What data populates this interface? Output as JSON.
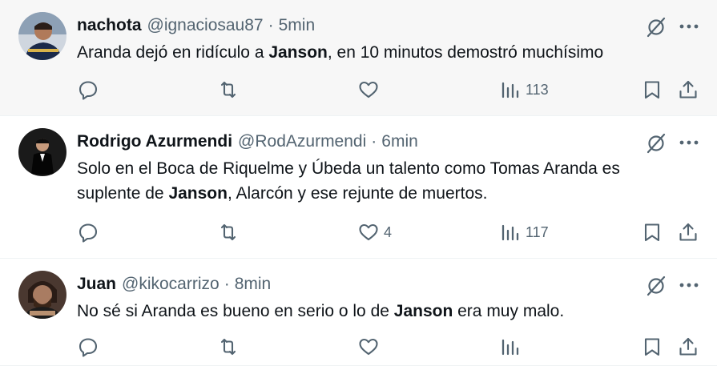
{
  "tweets": [
    {
      "name": "nachota",
      "handle": "@ignaciosau87",
      "separator": "·",
      "time": "5min",
      "text_parts": [
        {
          "text": "Aranda dejó en ridículo a ",
          "bold": false
        },
        {
          "text": "Janson",
          "bold": true
        },
        {
          "text": ", en 10 minutos demostró muchísimo",
          "bold": false
        }
      ],
      "replies": "",
      "retweets": "",
      "likes": "",
      "views": "113",
      "avatar_colors": [
        "#1b2a4a",
        "#d8b24a"
      ]
    },
    {
      "name": "Rodrigo Azurmendi",
      "handle": "@RodAzurmendi",
      "separator": "·",
      "time": "6min",
      "text_parts": [
        {
          "text": "Solo en el Boca de Riquelme y Úbeda un talento como Tomas Aranda es suplente de ",
          "bold": false
        },
        {
          "text": "Janson",
          "bold": true
        },
        {
          "text": ", Alarcón y ese rejunte de muertos.",
          "bold": false
        }
      ],
      "replies": "",
      "retweets": "",
      "likes": "4",
      "views": "117",
      "avatar_colors": [
        "#111111",
        "#e0e0e0"
      ]
    },
    {
      "name": "Juan",
      "handle": "@kikocarrizo",
      "separator": "·",
      "time": "8min",
      "text_parts": [
        {
          "text": "No sé si Aranda es bueno en serio o lo de ",
          "bold": false
        },
        {
          "text": "Janson",
          "bold": true
        },
        {
          "text": " era muy malo.",
          "bold": false
        }
      ],
      "replies": "",
      "retweets": "",
      "likes": "",
      "views": "",
      "avatar_colors": [
        "#3a2a22",
        "#b89070"
      ]
    }
  ],
  "icons": {
    "reply": "reply-icon",
    "retweet": "retweet-icon",
    "like": "heart-icon",
    "views": "views-icon",
    "bookmark": "bookmark-icon",
    "share": "share-icon",
    "grok": "grok-icon",
    "more": "more-icon"
  },
  "colors": {
    "text": "#0f1419",
    "secondary": "#536471",
    "highlight_background": "#f7f7f7",
    "divider": "#eff3f4"
  }
}
